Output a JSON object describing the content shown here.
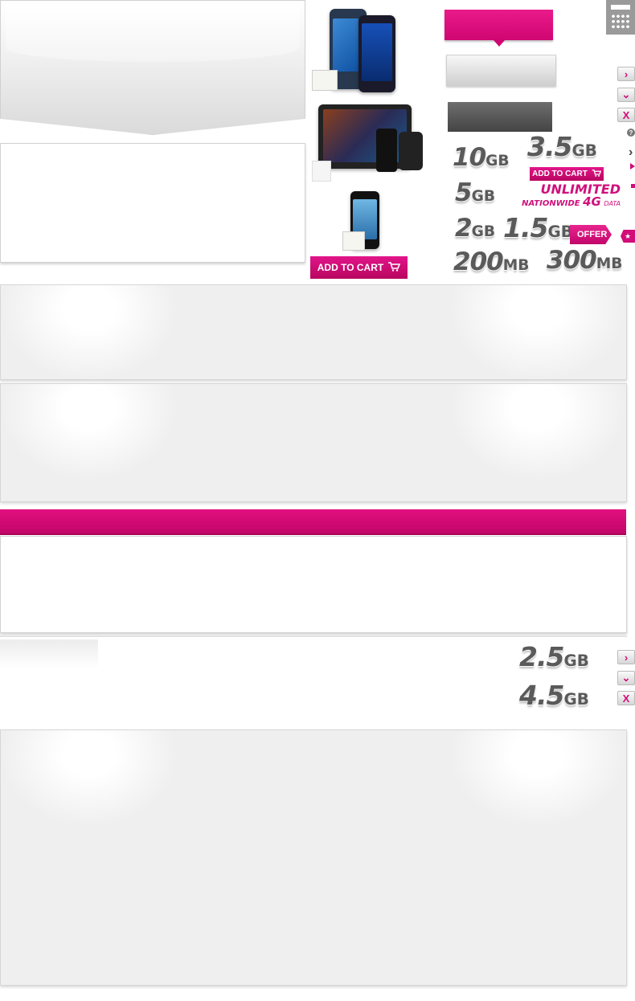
{
  "buttons": {
    "add_to_cart_large": "ADD TO CART",
    "add_to_cart_small": "ADD TO CART",
    "offer": "OFFER"
  },
  "data_sizes": {
    "s10": {
      "num": "10",
      "unit": "GB"
    },
    "s3_5": {
      "num": "3.5",
      "unit": "GB"
    },
    "s5": {
      "num": "5",
      "unit": "GB"
    },
    "s2": {
      "num": "2",
      "unit": "GB"
    },
    "s1_5": {
      "num": "1.5",
      "unit": "GB"
    },
    "s200": {
      "num": "200",
      "unit": "MB"
    },
    "s300": {
      "num": "300",
      "unit": "MB"
    },
    "s2_5": {
      "num": "2.5",
      "unit": "GB"
    },
    "s4_5": {
      "num": "4.5",
      "unit": "GB"
    }
  },
  "unlimited": {
    "line1": "UNLIMITED",
    "line2": "NATIONWIDE",
    "line3": "4G",
    "line4": "DATA"
  },
  "icons": {
    "next": "›",
    "down": "⌄",
    "close": "X",
    "help": "?",
    "star": "★"
  },
  "colors": {
    "brand_magenta": "#e20074",
    "grey_text": "#5a5a5a"
  }
}
